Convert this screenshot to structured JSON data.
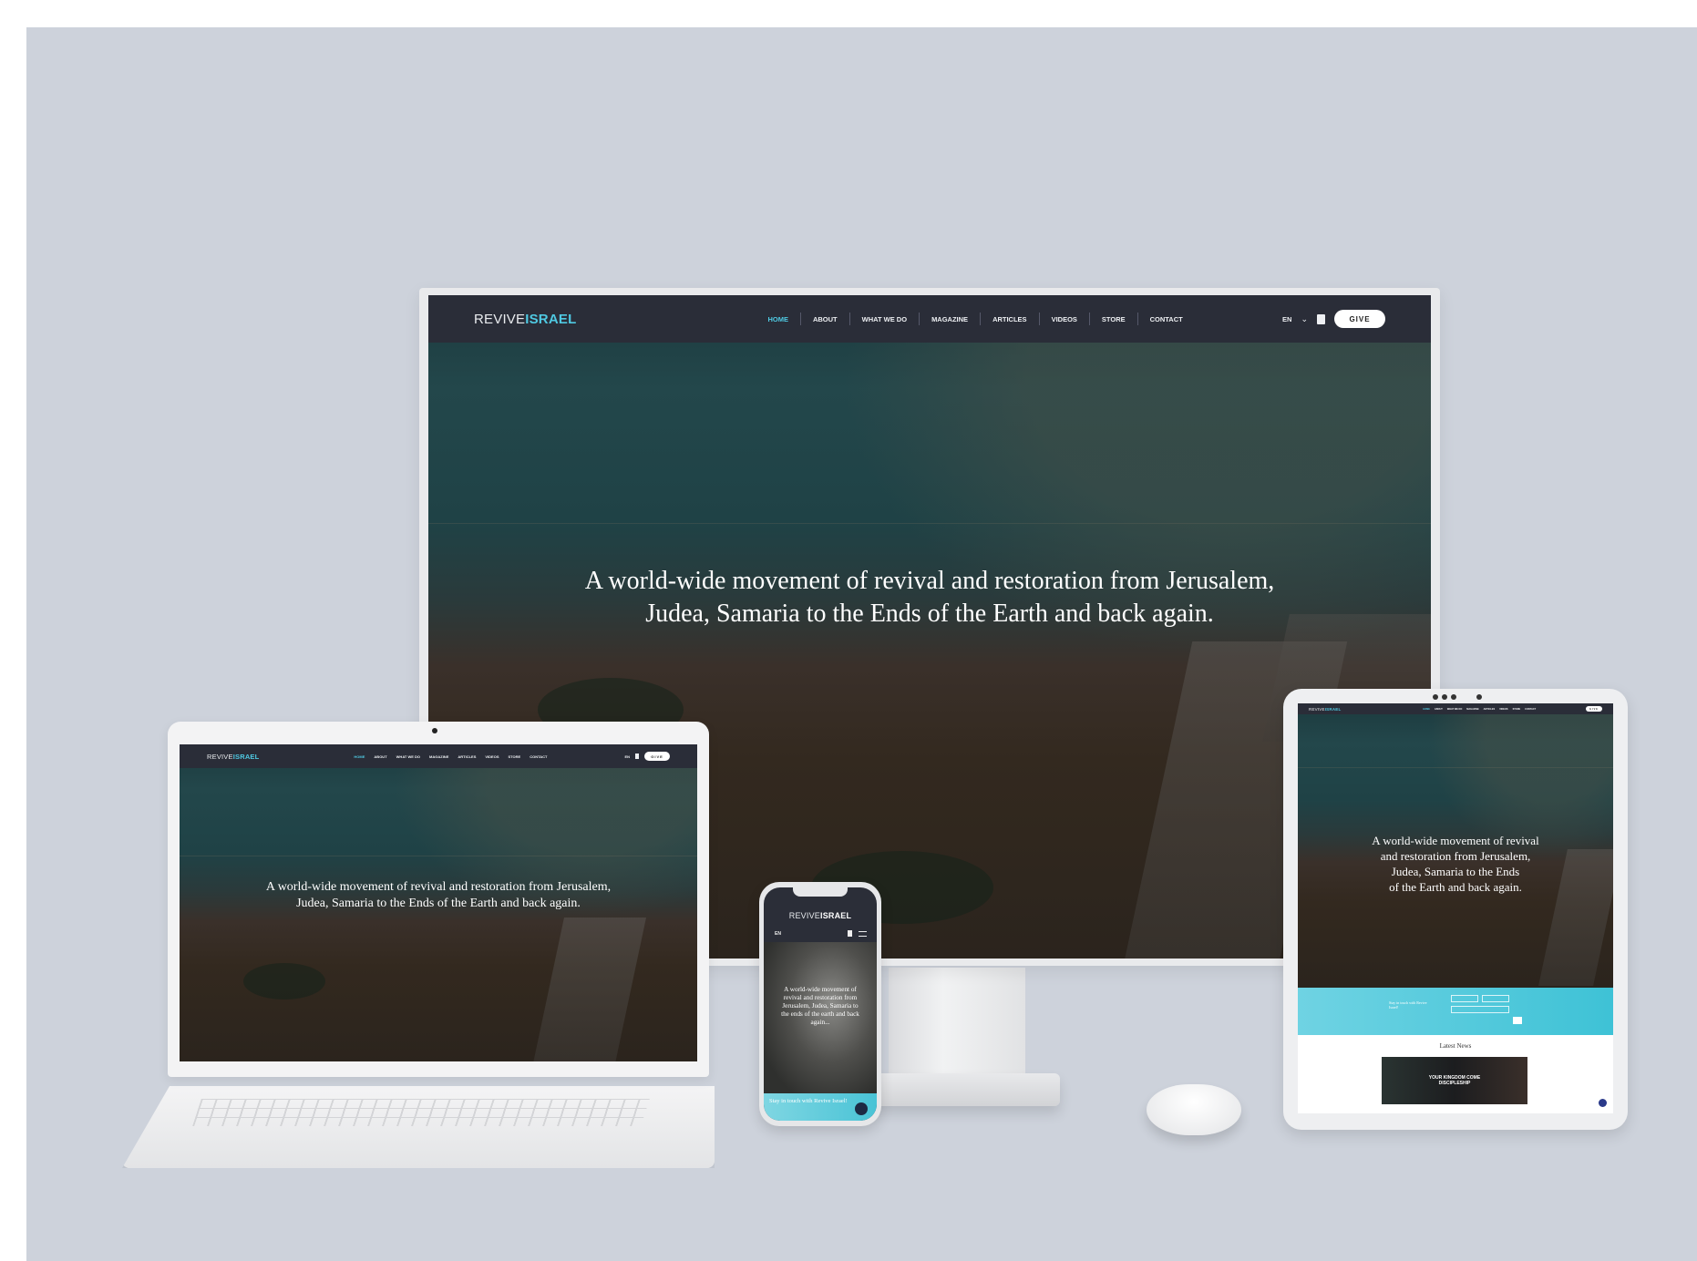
{
  "brand": {
    "revive": "REVIVE",
    "israel": "ISRAEL"
  },
  "nav": {
    "items": [
      "HOME",
      "ABOUT",
      "WHAT WE DO",
      "MAGAZINE",
      "ARTICLES",
      "VIDEOS",
      "STORE",
      "CONTACT"
    ],
    "active": "HOME",
    "language": "EN",
    "give_label": "GIVE"
  },
  "hero": {
    "line1": "A world-wide movement of revival and restoration from Jerusalem,",
    "line2": "Judea, Samaria to the Ends of the Earth and back again."
  },
  "tablet": {
    "heading_lines": [
      "A world-wide movement of revival",
      "and restoration from Jerusalem,",
      "Judea, Samaria to the Ends",
      "of the Earth and back again."
    ],
    "contact_title": "Stay in touch with Revive Israel!",
    "news_title": "Latest News",
    "news_banner": "YOUR KINGDOM COME DISCIPLESHIP"
  },
  "phone": {
    "language": "EN",
    "heading_lines": [
      "A world-wide movement of",
      "revival and restoration from",
      "Jerusalem, Judea, Samaria to",
      "the ends of the earth and back",
      "again..."
    ],
    "footer_text": "Stay in touch with Revive Israel!"
  },
  "colors": {
    "accent": "#4fc9e2",
    "navbar": "#2a2d38",
    "backdrop": "#cdd2db"
  }
}
